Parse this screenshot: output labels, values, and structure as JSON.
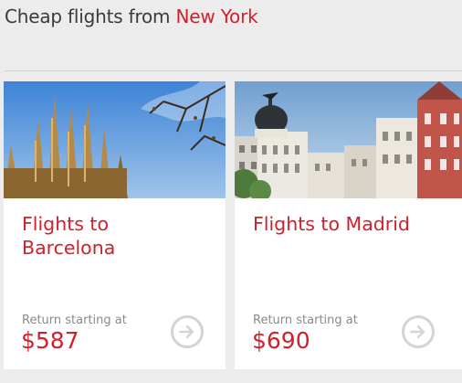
{
  "header": {
    "title_prefix": "Cheap flights from",
    "origin_city": "New York"
  },
  "cards": [
    {
      "title_line1": "Flights to",
      "title_line2": "Barcelona",
      "return_label": "Return starting at",
      "price": "$587",
      "arrow_icon": "arrow-right-icon"
    },
    {
      "title_line1": "Flights to Madrid",
      "title_line2": "",
      "return_label": "Return starting at",
      "price": "$690",
      "arrow_icon": "arrow-right-icon"
    }
  ],
  "colors": {
    "accent": "#d1202b",
    "text": "#3a3a3a",
    "muted": "#8a8a8a",
    "background": "#ececec",
    "card": "#ffffff"
  }
}
